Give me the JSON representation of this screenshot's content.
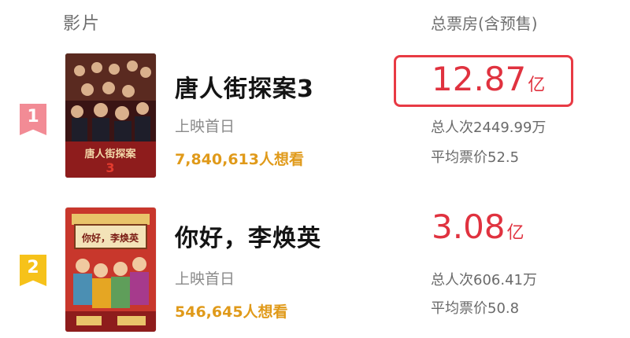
{
  "header": {
    "film_label": "影片",
    "gross_label": "总票房(含预售)"
  },
  "films": [
    {
      "rank": "1",
      "title": "唐人街探案3",
      "release_status": "上映首日",
      "want_to_see": "7,840,613人想看",
      "gross_value": "12.87",
      "gross_unit": "亿",
      "total_viewers": "总人次2449.99万",
      "avg_price": "平均票价52.5",
      "poster_text": "唐人街探案"
    },
    {
      "rank": "2",
      "title": "你好，李焕英",
      "release_status": "上映首日",
      "want_to_see": "546,645人想看",
      "gross_value": "3.08",
      "gross_unit": "亿",
      "total_viewers": "总人次606.41万",
      "avg_price": "平均票价50.8",
      "poster_text": "你好，李焕英"
    }
  ],
  "colors": {
    "rank1_badge": "#f28b95",
    "rank2_badge": "#f6c21a",
    "gross_red": "#e0323f",
    "want_orange": "#e09a1a"
  }
}
